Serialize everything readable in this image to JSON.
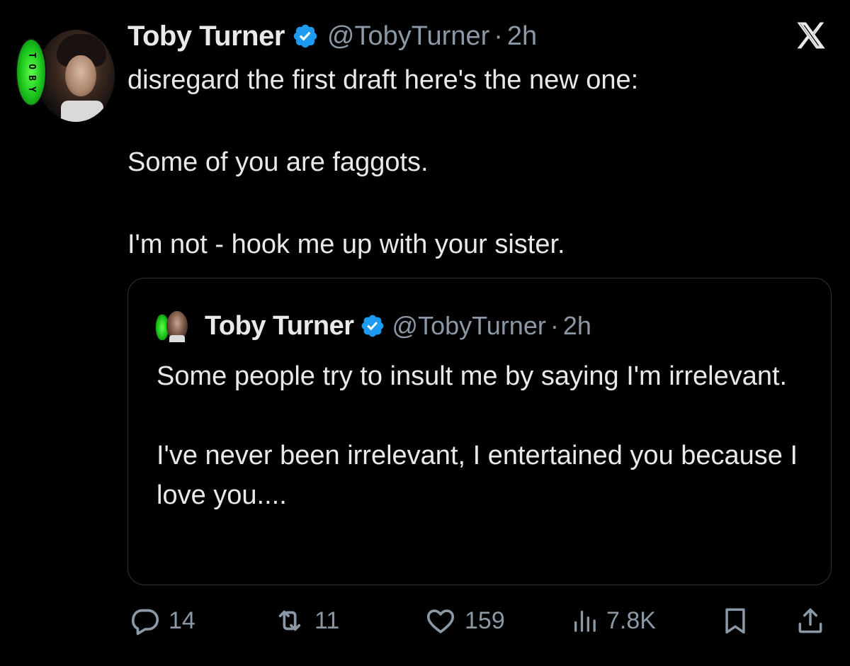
{
  "tweet": {
    "author": {
      "name": "Toby Turner",
      "handle": "@TobyTurner",
      "badge_letters": [
        "T",
        "O",
        "B",
        "Y"
      ]
    },
    "separator": "·",
    "time": "2h",
    "lines": [
      "disregard the first draft here's the new one:",
      "Some of you are faggots.",
      "I'm not - hook me up with your sister."
    ]
  },
  "quote": {
    "author": {
      "name": "Toby Turner",
      "handle": "@TobyTurner"
    },
    "separator": "·",
    "time": "2h",
    "lines": [
      "Some people try to insult me by saying I'm irrelevant.",
      "I've never been irrelevant, I entertained you because I love you...."
    ]
  },
  "actions": {
    "replies": "14",
    "reposts": "11",
    "likes": "159",
    "views": "7.8K"
  },
  "colors": {
    "background": "#000000",
    "text": "#e7e9ea",
    "secondary_text": "#8b98a5",
    "verified_blue": "#1d9bf0",
    "border": "#2f3336",
    "badge_green": "#19c21a"
  },
  "icons": {
    "platform_logo": "x-logo-icon",
    "verified": "verified-badge-icon",
    "reply": "reply-icon",
    "repost": "repost-icon",
    "like": "heart-icon",
    "views": "views-chart-icon",
    "bookmark": "bookmark-icon",
    "share": "share-icon"
  }
}
